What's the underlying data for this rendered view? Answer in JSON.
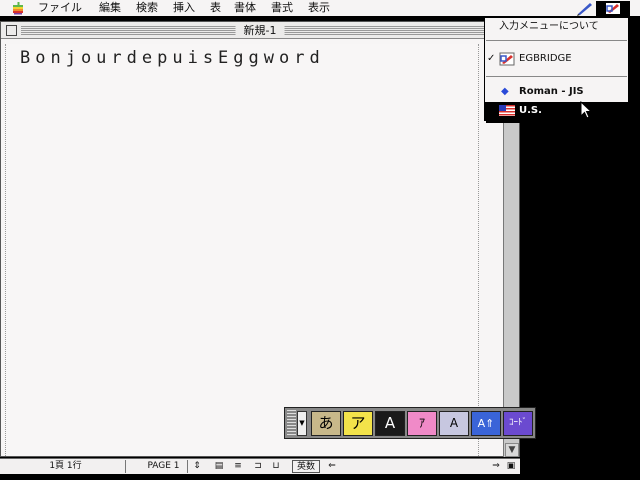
{
  "menubar": {
    "items": [
      "ファイル",
      "編集",
      "検索",
      "挿入",
      "表",
      "書体",
      "書式",
      "表示"
    ]
  },
  "window": {
    "title": "新規-1"
  },
  "document": {
    "text": "BonjourdepuisEggword"
  },
  "statusbar": {
    "position": "1頁 1行",
    "page": "PAGE 1",
    "mode": "英数"
  },
  "palette": {
    "keys": [
      "あ",
      "ア",
      "A",
      "ｱ",
      "A",
      "A⇑",
      "ｺｰﾄﾞ"
    ]
  },
  "input_menu": {
    "about": "入力メニューについて",
    "egbridge": "EGBRIDGE",
    "roman_jis": "Roman - JIS",
    "us": "U.S."
  },
  "colors": {
    "palette_hira": "#c8b88a",
    "palette_kata": "#f3e34a",
    "palette_fullA": "#1a1a1a",
    "palette_halfkana": "#f08ac8",
    "palette_halfA": "#c7c7e0",
    "palette_capsA": "#3a64d8",
    "palette_code": "#6b4ad0"
  }
}
